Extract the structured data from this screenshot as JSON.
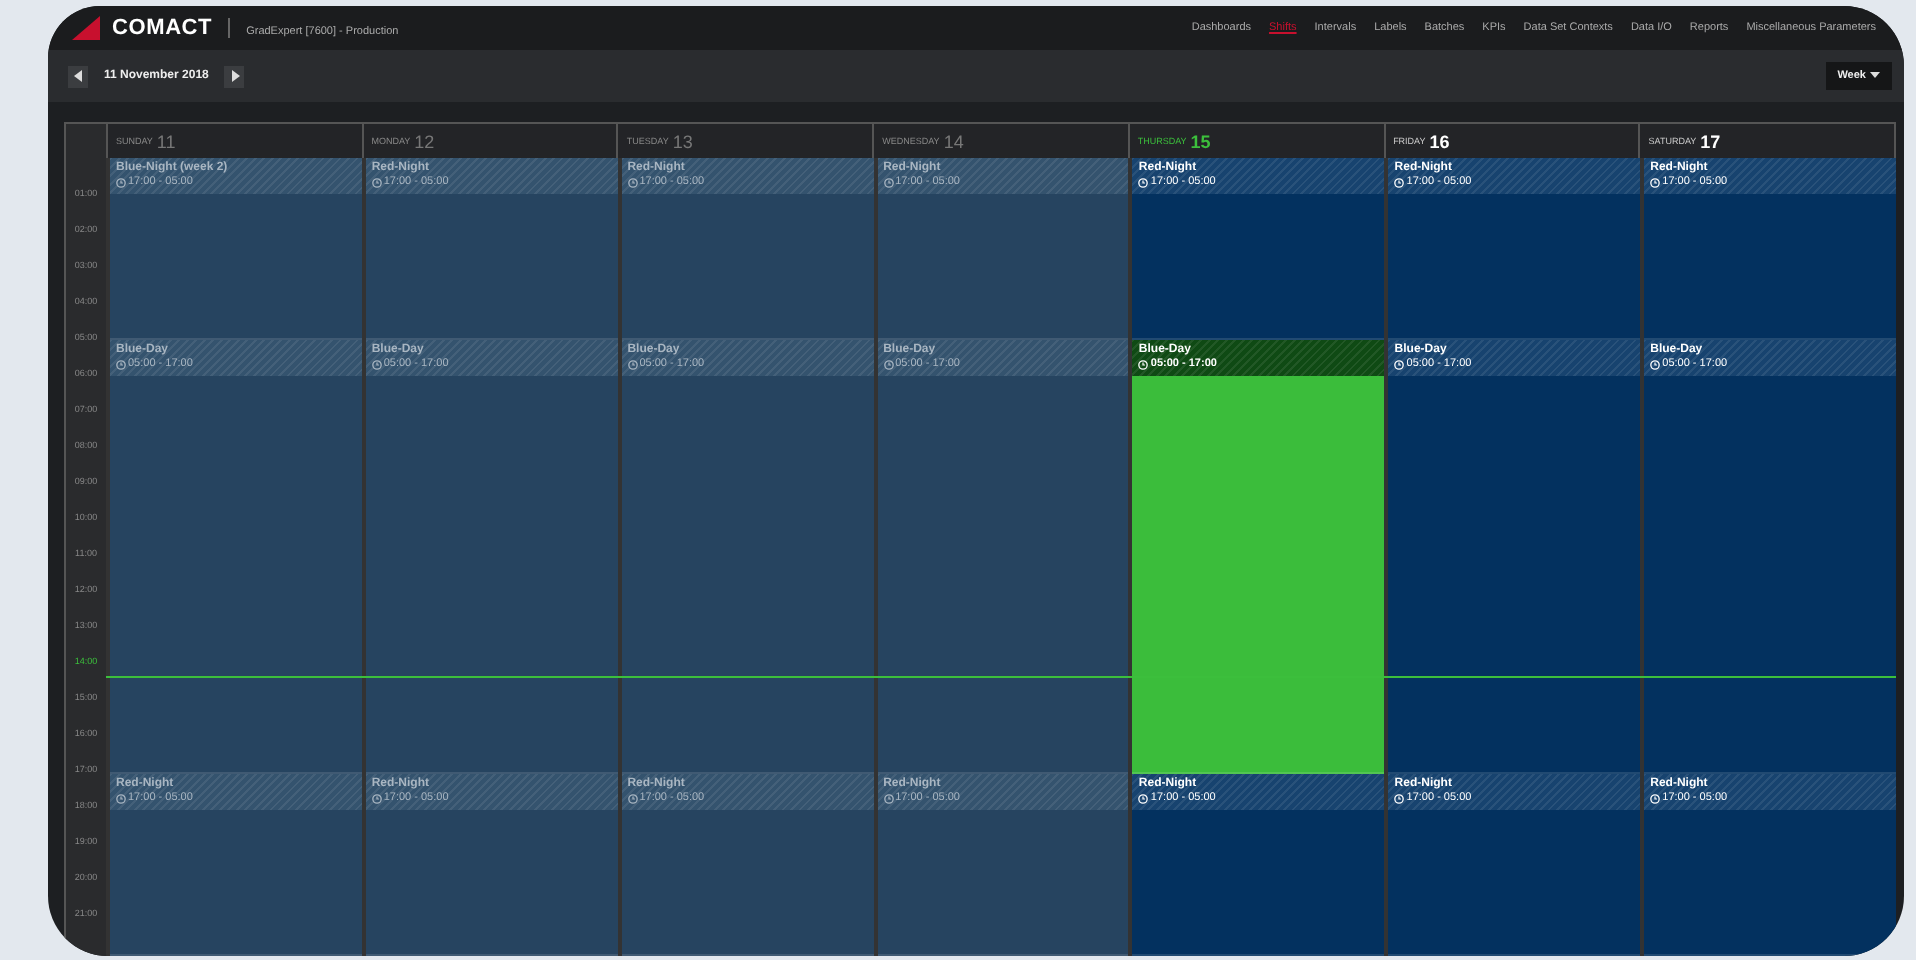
{
  "app": {
    "logo": "COMACT",
    "context": "GradExpert [7600] - Production"
  },
  "nav": [
    {
      "label": "Dashboards",
      "selected": false
    },
    {
      "label": "Shifts",
      "selected": true
    },
    {
      "label": "Intervals",
      "selected": false
    },
    {
      "label": "Labels",
      "selected": false
    },
    {
      "label": "Batches",
      "selected": false
    },
    {
      "label": "KPIs",
      "selected": false
    },
    {
      "label": "Data Set Contexts",
      "selected": false
    },
    {
      "label": "Data I/O",
      "selected": false
    },
    {
      "label": "Reports",
      "selected": false
    },
    {
      "label": "Miscellaneous Parameters",
      "selected": false
    }
  ],
  "toolbar": {
    "date": "11 November 2018",
    "view": "Week"
  },
  "hours": [
    {
      "label": "01:00",
      "current": false
    },
    {
      "label": "02:00",
      "current": false
    },
    {
      "label": "03:00",
      "current": false
    },
    {
      "label": "04:00",
      "current": false
    },
    {
      "label": "05:00",
      "current": false
    },
    {
      "label": "06:00",
      "current": false
    },
    {
      "label": "07:00",
      "current": false
    },
    {
      "label": "08:00",
      "current": false
    },
    {
      "label": "09:00",
      "current": false
    },
    {
      "label": "10:00",
      "current": false
    },
    {
      "label": "11:00",
      "current": false
    },
    {
      "label": "12:00",
      "current": false
    },
    {
      "label": "13:00",
      "current": false
    },
    {
      "label": "14:00",
      "current": true
    },
    {
      "label": "15:00",
      "current": false
    },
    {
      "label": "16:00",
      "current": false
    },
    {
      "label": "17:00",
      "current": false
    },
    {
      "label": "18:00",
      "current": false
    },
    {
      "label": "19:00",
      "current": false
    },
    {
      "label": "20:00",
      "current": false
    },
    {
      "label": "21:00",
      "current": false
    }
  ],
  "days": [
    {
      "weekday": "SUNDAY",
      "date": "11",
      "past": true,
      "today": false,
      "events": [
        {
          "title": "Blue-Night (week 2)",
          "time": "17:00 - 05:00",
          "active": false
        },
        {
          "title": "Blue-Day",
          "time": "05:00 - 17:00",
          "active": false
        },
        {
          "title": "Red-Night",
          "time": "17:00 - 05:00",
          "active": false
        }
      ]
    },
    {
      "weekday": "MONDAY",
      "date": "12",
      "past": true,
      "today": false,
      "events": [
        {
          "title": "Red-Night",
          "time": "17:00 - 05:00",
          "active": false
        },
        {
          "title": "Blue-Day",
          "time": "05:00 - 17:00",
          "active": false
        },
        {
          "title": "Red-Night",
          "time": "17:00 - 05:00",
          "active": false
        }
      ]
    },
    {
      "weekday": "TUESDAY",
      "date": "13",
      "past": true,
      "today": false,
      "events": [
        {
          "title": "Red-Night",
          "time": "17:00 - 05:00",
          "active": false
        },
        {
          "title": "Blue-Day",
          "time": "05:00 - 17:00",
          "active": false
        },
        {
          "title": "Red-Night",
          "time": "17:00 - 05:00",
          "active": false
        }
      ]
    },
    {
      "weekday": "WEDNESDAY",
      "date": "14",
      "past": true,
      "today": false,
      "events": [
        {
          "title": "Red-Night",
          "time": "17:00 - 05:00",
          "active": false
        },
        {
          "title": "Blue-Day",
          "time": "05:00 - 17:00",
          "active": false
        },
        {
          "title": "Red-Night",
          "time": "17:00 - 05:00",
          "active": false
        }
      ]
    },
    {
      "weekday": "THURSDAY",
      "date": "15",
      "past": false,
      "today": true,
      "events": [
        {
          "title": "Red-Night",
          "time": "17:00 - 05:00",
          "active": false
        },
        {
          "title": "Blue-Day",
          "time": "05:00 - 17:00",
          "active": true
        },
        {
          "title": "Red-Night",
          "time": "17:00 - 05:00",
          "active": false
        }
      ]
    },
    {
      "weekday": "FRIDAY",
      "date": "16",
      "past": false,
      "today": false,
      "events": [
        {
          "title": "Red-Night",
          "time": "17:00 - 05:00",
          "active": false
        },
        {
          "title": "Blue-Day",
          "time": "05:00 - 17:00",
          "active": false
        },
        {
          "title": "Red-Night",
          "time": "17:00 - 05:00",
          "active": false
        }
      ]
    },
    {
      "weekday": "SATURDAY",
      "date": "17",
      "past": false,
      "today": false,
      "events": [
        {
          "title": "Red-Night",
          "time": "17:00 - 05:00",
          "active": false
        },
        {
          "title": "Blue-Day",
          "time": "05:00 - 17:00",
          "active": false
        },
        {
          "title": "Red-Night",
          "time": "17:00 - 05:00",
          "active": false
        }
      ]
    }
  ]
}
